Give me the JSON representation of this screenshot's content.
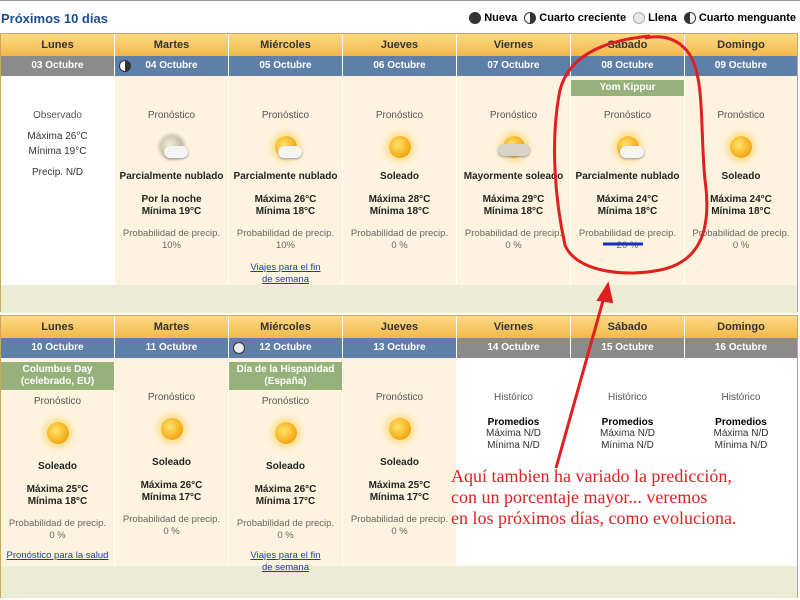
{
  "title": "Próximos 10 días",
  "legend": [
    {
      "label": "Nueva",
      "icon": "new-moon-icon"
    },
    {
      "label": "Cuarto creciente",
      "icon": "first-quarter-moon-icon"
    },
    {
      "label": "Llena",
      "icon": "full-moon-icon"
    },
    {
      "label": "Cuarto menguante",
      "icon": "last-quarter-moon-icon"
    }
  ],
  "week1": {
    "days": [
      {
        "name": "Lunes",
        "date": "03 Octubre",
        "kind": "Observado",
        "max": "Máxima 26°C",
        "min": "Mínima 19°C",
        "precip": "Precip. N/D"
      },
      {
        "name": "Martes",
        "date": "04 Octubre",
        "kind": "Pronóstico",
        "desc": "Parcialmente nublado",
        "max": "Por la noche",
        "min": "Mínima 19°C",
        "precip_label": "Probabilidad de precip.",
        "precip": "10%",
        "icon": "partly-cloudy-night-icon"
      },
      {
        "name": "Miércoles",
        "date": "05 Octubre",
        "kind": "Pronóstico",
        "desc": "Parcialmente nublado",
        "max": "Máxima 26°C",
        "min": "Mínima 18°C",
        "precip_label": "Probabilidad de precip.",
        "precip": "10%",
        "link": "Viajes para el fin de semana",
        "icon": "partly-cloudy-icon"
      },
      {
        "name": "Jueves",
        "date": "06 Octubre",
        "kind": "Pronóstico",
        "desc": "Soleado",
        "max": "Máxima 28°C",
        "min": "Mínima 18°C",
        "precip_label": "Probabilidad de precip.",
        "precip": "0 %",
        "icon": "sun-icon"
      },
      {
        "name": "Viernes",
        "date": "07 Octubre",
        "kind": "Pronóstico",
        "desc": "Mayormente soleado",
        "max": "Máxima 29°C",
        "min": "Mínima 18°C",
        "precip_label": "Probabilidad de precip.",
        "precip": "0 %",
        "icon": "mostly-sunny-icon"
      },
      {
        "name": "Sábado",
        "date": "08 Octubre",
        "holiday": "Yom Kippur",
        "kind": "Pronóstico",
        "desc": "Parcialmente nublado",
        "max": "Máxima 24°C",
        "min": "Mínima 18°C",
        "precip_label": "Probabilidad de precip.",
        "precip": "20 %",
        "icon": "partly-cloudy-icon"
      },
      {
        "name": "Domingo",
        "date": "09 Octubre",
        "kind": "Pronóstico",
        "desc": "Soleado",
        "max": "Máxima 24°C",
        "min": "Mínima 18°C",
        "precip_label": "Probabilidad de precip.",
        "precip": "0 %",
        "icon": "sun-icon"
      }
    ]
  },
  "week2": {
    "days": [
      {
        "name": "Lunes",
        "date": "10 Octubre",
        "holiday": "Columbus Day (celebrado, EU)",
        "kind": "Pronóstico",
        "desc": "Soleado",
        "max": "Máxima 25°C",
        "min": "Mínima 18°C",
        "precip_label": "Probabilidad de precip.",
        "precip": "0 %",
        "link": "Pronóstico para la salud",
        "icon": "sun-icon"
      },
      {
        "name": "Martes",
        "date": "11 Octubre",
        "kind": "Pronóstico",
        "desc": "Soleado",
        "max": "Máxima 26°C",
        "min": "Mínima 17°C",
        "precip_label": "Probabilidad de precip.",
        "precip": "0 %",
        "icon": "sun-icon"
      },
      {
        "name": "Miércoles",
        "date": "12 Octubre",
        "holiday": "Día de la Hispanidad (España)",
        "kind": "Pronóstico",
        "desc": "Soleado",
        "max": "Máxima 26°C",
        "min": "Mínima 17°C",
        "precip_label": "Probabilidad de precip.",
        "precip": "0 %",
        "link": "Viajes para el fin de semana",
        "icon": "sun-icon"
      },
      {
        "name": "Jueves",
        "date": "13 Octubre",
        "kind": "Pronóstico",
        "desc": "Soleado",
        "max": "Máxima 25°C",
        "min": "Mínima 17°C",
        "precip_label": "Probabilidad de precip.",
        "precip": "0 %",
        "icon": "sun-icon"
      },
      {
        "name": "Viernes",
        "date": "14 Octubre",
        "kind": "Histórico",
        "avg": "Promedios",
        "max": "Máxima N/D",
        "min": "Mínima N/D"
      },
      {
        "name": "Sábado",
        "date": "15 Octubre",
        "kind": "Histórico",
        "avg": "Promedios",
        "max": "Máxima N/D",
        "min": "Mínima N/D"
      },
      {
        "name": "Domingo",
        "date": "16 Octubre",
        "kind": "Histórico",
        "avg": "Promedios",
        "max": "Máxima N/D",
        "min": "Mínima N/D"
      }
    ]
  },
  "annotation": {
    "lines": [
      "Aquí tambien ha variado la predicción,",
      "con un porcentaje mayor... veremos",
      "en los próximos días, como evoluciona."
    ],
    "color": "#e02020"
  }
}
